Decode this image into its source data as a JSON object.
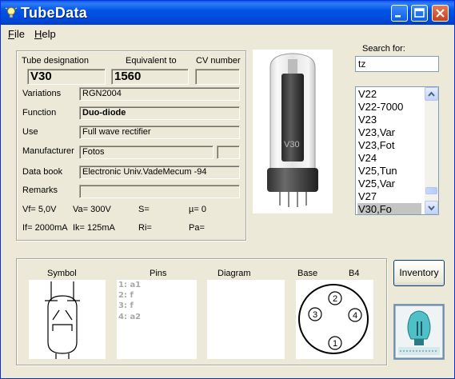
{
  "window": {
    "title": "TubeData"
  },
  "menu": {
    "file": "File",
    "help": "Help"
  },
  "labels": {
    "tube_designation": "Tube designation",
    "equivalent_to": "Equivalent to",
    "cv_number": "CV number",
    "variations": "Variations",
    "function": "Function",
    "use": "Use",
    "manufacturer": "Manufacturer",
    "data_book": "Data book",
    "remarks": "Remarks",
    "search_for": "Search for:",
    "symbol": "Symbol",
    "pins": "Pins",
    "diagram": "Diagram",
    "base": "Base",
    "base_code": "B4"
  },
  "values": {
    "tube_designation": "V30",
    "equivalent_to": "1560",
    "cv_number": "",
    "variations": "RGN2004",
    "function": "Duo-diode",
    "use": "Full wave rectifier",
    "manufacturer": "Fotos",
    "manufacturer_extra": "",
    "data_book": "Electronic Univ.VadeMecum -94",
    "remarks": ""
  },
  "params": {
    "vf": "Vf= 5,0V",
    "va": "Va= 300V",
    "s": "S=",
    "mu": "µ=   0",
    "if": "If= 2000mA",
    "ik": "Ik=  125mA",
    "ri": "Ri=",
    "pa": "Pa="
  },
  "search": {
    "value": "tz"
  },
  "results": [
    "V22",
    "V22-7000",
    "V23",
    "V23,Var",
    "V23,Fot",
    "V24",
    "V25,Tun",
    "V25,Var",
    "V27",
    "V30,Fo"
  ],
  "selected_result": "V30,Fo",
  "pins": [
    "1: a1",
    "2: f",
    "3: f",
    "4: a2"
  ],
  "base_pins": [
    "1",
    "2",
    "3",
    "4"
  ],
  "buttons": {
    "inventory": "Inventory"
  },
  "tube_photo_marking": "V30",
  "colors": {
    "titlebar": "#0055e5",
    "window_bg": "#ece9d8",
    "selection": "#c4c4c4",
    "close_button": "#c4401d"
  },
  "icons": [
    "bulb-icon",
    "minimize-icon",
    "maximize-icon",
    "close-icon",
    "scroll-up-icon",
    "scroll-down-icon"
  ]
}
